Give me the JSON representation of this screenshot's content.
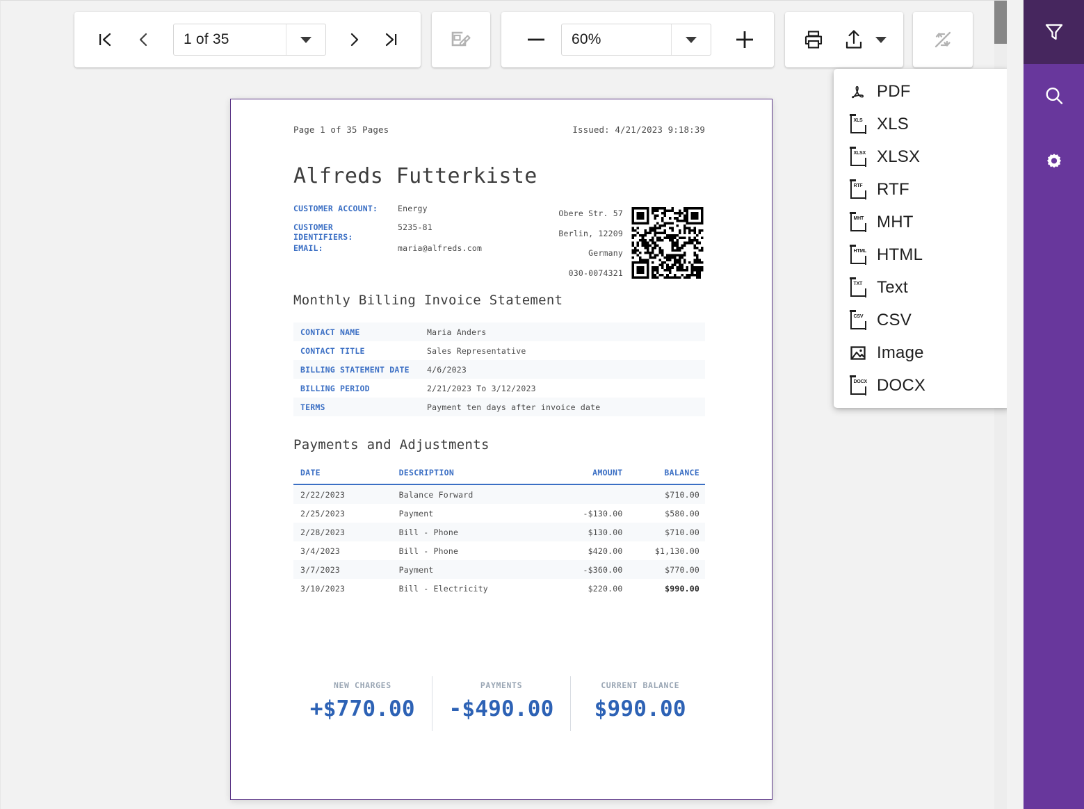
{
  "toolbar": {
    "nav_first": "first-page",
    "nav_prev": "previous-page",
    "nav_next": "next-page",
    "nav_last": "last-page",
    "page_value": "1 of 35",
    "edit_label": "edit-document",
    "zoom_out_label": "zoom-out",
    "zoom_value": "60%",
    "zoom_in_label": "zoom-in",
    "print_label": "print",
    "export_label": "export",
    "multipage_label": "toggle-multipage"
  },
  "export_menu": {
    "items": [
      {
        "label": "PDF",
        "ext": "",
        "icon": "pdf-icon"
      },
      {
        "label": "XLS",
        "ext": "XLS",
        "icon": "xls-file-icon"
      },
      {
        "label": "XLSX",
        "ext": "XLSX",
        "icon": "xlsx-file-icon"
      },
      {
        "label": "RTF",
        "ext": "RTF",
        "icon": "rtf-file-icon"
      },
      {
        "label": "MHT",
        "ext": "MHT",
        "icon": "mht-file-icon"
      },
      {
        "label": "HTML",
        "ext": "HTML",
        "icon": "html-file-icon"
      },
      {
        "label": "Text",
        "ext": "TXT",
        "icon": "txt-file-icon"
      },
      {
        "label": "CSV",
        "ext": "CSV",
        "icon": "csv-file-icon"
      },
      {
        "label": "Image",
        "ext": "",
        "icon": "image-icon"
      },
      {
        "label": "DOCX",
        "ext": "DOCX",
        "icon": "docx-file-icon"
      }
    ]
  },
  "document": {
    "page_label": "Page 1 of 35 Pages",
    "issued": "Issued: 4/21/2023 9:18:39",
    "company": "Alfreds Futterkiste",
    "customer": [
      {
        "label": "CUSTOMER ACCOUNT:",
        "value": "Energy"
      },
      {
        "label": "CUSTOMER IDENTIFIERS:",
        "value": "5235-81"
      },
      {
        "label": "EMAIL:",
        "value": "maria@alfreds.com"
      }
    ],
    "address": [
      "Obere Str. 57",
      "Berlin,  12209",
      "Germany",
      "030-0074321"
    ],
    "statement_title": "Monthly Billing Invoice Statement",
    "info_rows": [
      {
        "key": "CONTACT NAME",
        "value": "Maria Anders"
      },
      {
        "key": "CONTACT TITLE",
        "value": "Sales Representative"
      },
      {
        "key": "BILLING STATEMENT DATE",
        "value": "4/6/2023"
      },
      {
        "key": "BILLING PERIOD",
        "value": "2/21/2023 To 3/12/2023"
      },
      {
        "key": "TERMS",
        "value": "Payment ten days after invoice date"
      }
    ],
    "payments_title": "Payments and Adjustments",
    "payments_headers": [
      "DATE",
      "DESCRIPTION",
      "AMOUNT",
      "BALANCE"
    ],
    "payments_rows": [
      {
        "date": "2/22/2023",
        "description": "Balance Forward",
        "amount": "",
        "balance": "$710.00",
        "bold": false
      },
      {
        "date": "2/25/2023",
        "description": "Payment",
        "amount": "-$130.00",
        "balance": "$580.00",
        "bold": false
      },
      {
        "date": "2/28/2023",
        "description": "Bill - Phone",
        "amount": "$130.00",
        "balance": "$710.00",
        "bold": false
      },
      {
        "date": "3/4/2023",
        "description": "Bill - Phone",
        "amount": "$420.00",
        "balance": "$1,130.00",
        "bold": false
      },
      {
        "date": "3/7/2023",
        "description": "Payment",
        "amount": "-$360.00",
        "balance": "$770.00",
        "bold": false
      },
      {
        "date": "3/10/2023",
        "description": "Bill - Electricity",
        "amount": "$220.00",
        "balance": "$990.00",
        "bold": true
      }
    ],
    "summary": [
      {
        "label": "NEW CHARGES",
        "value": "+$770.00"
      },
      {
        "label": "PAYMENTS",
        "value": "-$490.00"
      },
      {
        "label": "CURRENT BALANCE",
        "value": "$990.00"
      }
    ]
  },
  "rail": {
    "items": [
      {
        "icon": "filter-icon",
        "name": "rail-filter",
        "active": true
      },
      {
        "icon": "search-icon",
        "name": "rail-search",
        "active": false
      },
      {
        "icon": "gear-icon",
        "name": "rail-settings",
        "active": false
      }
    ]
  },
  "colors": {
    "rail": "#68379c",
    "rail_active": "#46265e",
    "doc_border": "#5b3687",
    "accent_blue": "#3b6fc4",
    "summary_blue": "#2d62b5"
  }
}
